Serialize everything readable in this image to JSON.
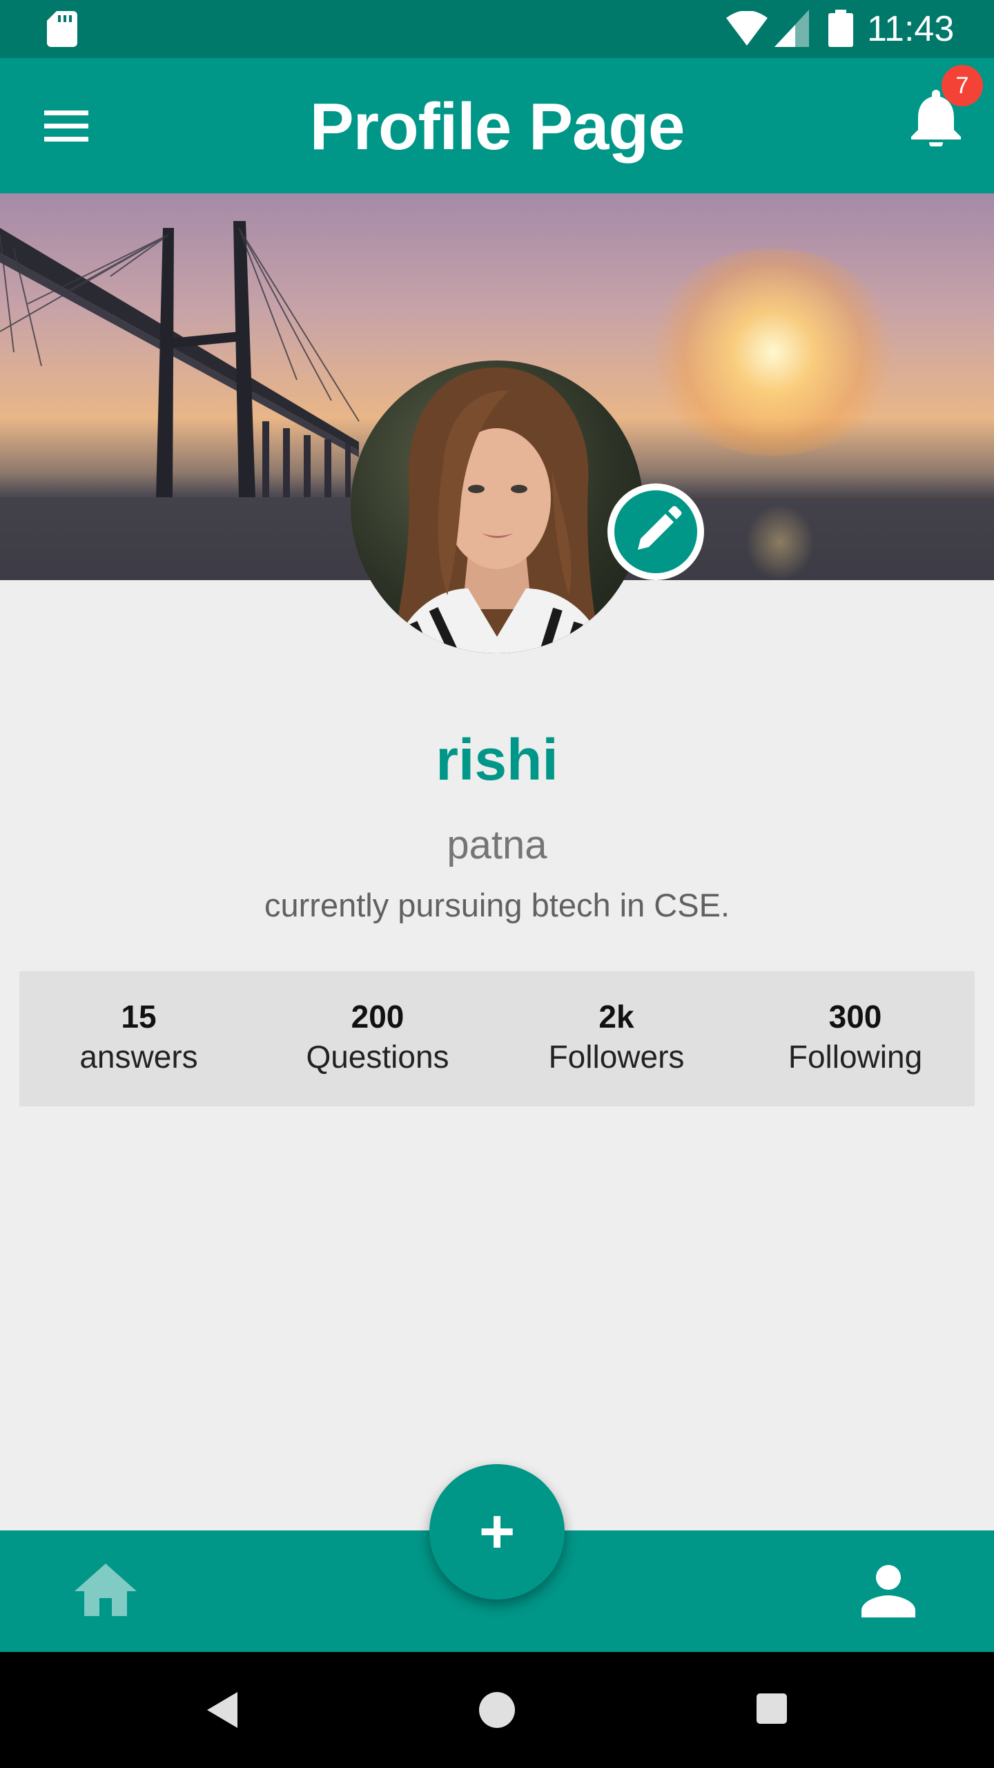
{
  "status_bar": {
    "time": "11:43",
    "icons": [
      "sd-card-icon",
      "wifi-icon",
      "signal-icon",
      "battery-icon"
    ]
  },
  "app_bar": {
    "title": "Profile Page",
    "menu_icon": "menu-icon",
    "notification_icon": "bell-icon",
    "notification_count": "7"
  },
  "profile": {
    "name": "rishi",
    "location": "patna",
    "bio": "currently pursuing btech in CSE.",
    "edit_icon": "pencil-icon"
  },
  "stats": [
    {
      "value": "15",
      "label": "answers"
    },
    {
      "value": "200",
      "label": "Questions"
    },
    {
      "value": "2k",
      "label": "Followers"
    },
    {
      "value": "300",
      "label": "Following"
    }
  ],
  "bottom_nav": {
    "fab_label": "+",
    "items": [
      "home-icon",
      "person-icon"
    ]
  },
  "colors": {
    "primary": "#009688",
    "primary_dark": "#00796b",
    "badge": "#f44336",
    "background": "#eeeeee",
    "stats_background": "#e0e0e0"
  }
}
